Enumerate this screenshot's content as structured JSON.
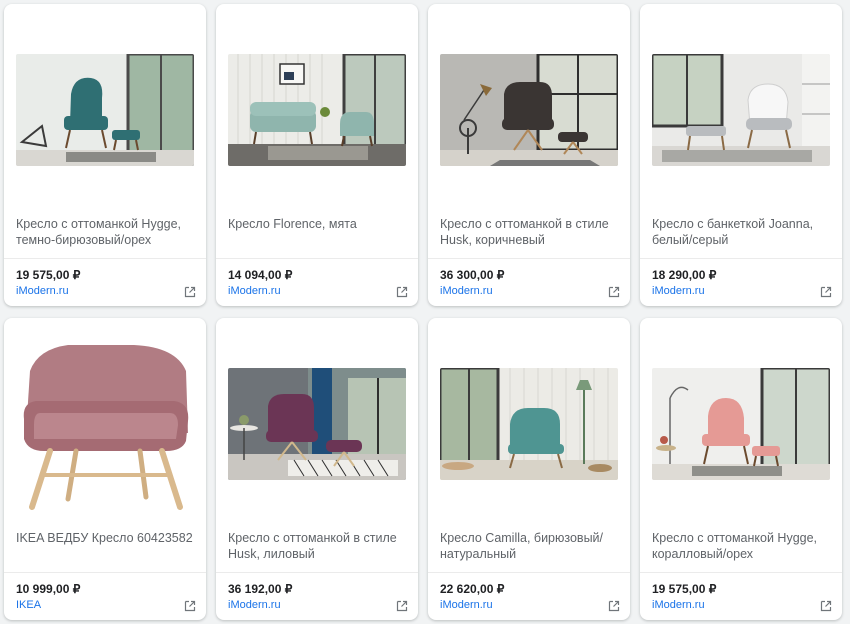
{
  "products": [
    {
      "title_line1": "Кресло с оттоманкой Hygge,",
      "title_line2": "темно-бирюзовый/орех",
      "price": "19 575,00 ₽",
      "source": "iModern.ru",
      "image": "teal wingback chair with ottoman in bright room",
      "chair_color": "#2f6f73"
    },
    {
      "title_line1": "Кресло Florence, мята",
      "title_line2": "",
      "price": "14 094,00 ₽",
      "source": "iModern.ru",
      "image": "mint sofa and armchair in living room",
      "chair_color": "#8fb5ad"
    },
    {
      "title_line1": "Кресло с оттоманкой в стиле",
      "title_line2": "Husk, коричневый",
      "price": "36 300,00 ₽",
      "source": "iModern.ru",
      "image": "dark quilted lounge chair with ottoman",
      "chair_color": "#3a3533"
    },
    {
      "title_line1": "Кресло с банкеткой Joanna,",
      "title_line2": "белый/серый",
      "price": "18 290,00 ₽",
      "source": "iModern.ru",
      "image": "white/grey lounge chair with footrest",
      "chair_color": "#b9bcbf"
    },
    {
      "title_line1": "IKEA ВЕДБУ Кресло 60423582",
      "title_line2": "",
      "price": "10 999,00 ₽",
      "source": "IKEA",
      "image": "pink armchair with birch legs on white background",
      "chair_color": "#b17c83"
    },
    {
      "title_line1": "Кресло с оттоманкой в стиле",
      "title_line2": "Husk, лиловый",
      "price": "36 192,00 ₽",
      "source": "iModern.ru",
      "image": "purple quilted lounge chair with ottoman",
      "chair_color": "#6b3555"
    },
    {
      "title_line1": "Кресло Camilla, бирюзовый/",
      "title_line2": "натуральный",
      "price": "22 620,00 ₽",
      "source": "iModern.ru",
      "image": "turquoise armchair next to floor lamp",
      "chair_color": "#4f9592"
    },
    {
      "title_line1": "Кресло с оттоманкой Hygge,",
      "title_line2": "коралловый/орех",
      "price": "19 575,00 ₽",
      "source": "iModern.ru",
      "image": "coral wingback chair with ottoman",
      "chair_color": "#e59a95"
    }
  ],
  "icons": {
    "external_link": "open-in-new-icon"
  },
  "colors": {
    "link": "#1a73e8",
    "price": "#202124",
    "title": "#5f6368"
  }
}
